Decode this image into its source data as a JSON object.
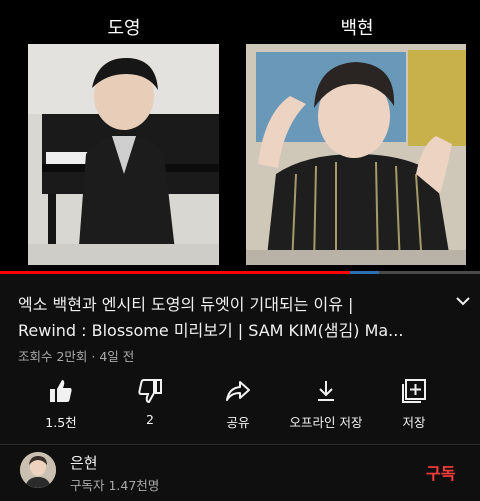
{
  "player": {
    "left_name": "도영",
    "right_name": "백현",
    "progress_watched_fraction": 0.73,
    "progress_buffered_fraction": 0.06
  },
  "video": {
    "title_line1": "엑소 백현과 엔시티 도영의 듀엣이 기대되는 이유 |",
    "title_line2": "Rewind : Blossome 미리보기 | SAM KIM(샘김) Ma...",
    "meta": "조회수 2만회 · 4일 전"
  },
  "actions": [
    {
      "icon": "thumbs-up-icon",
      "label": "1.5천"
    },
    {
      "icon": "thumbs-down-icon",
      "label": "2"
    },
    {
      "icon": "share-icon",
      "label": "공유"
    },
    {
      "icon": "download-icon",
      "label": "오프라인 저장"
    },
    {
      "icon": "add-to-playlist-icon",
      "label": "저장"
    }
  ],
  "channel": {
    "name": "은현",
    "subscribers": "구독자 1.47천명",
    "subscribe_label": "구독"
  },
  "colors": {
    "background": "#0f0f0f",
    "progress": "#ff0000",
    "subscribe": "#ff3d3d",
    "secondary_text": "#aaaaaa"
  }
}
